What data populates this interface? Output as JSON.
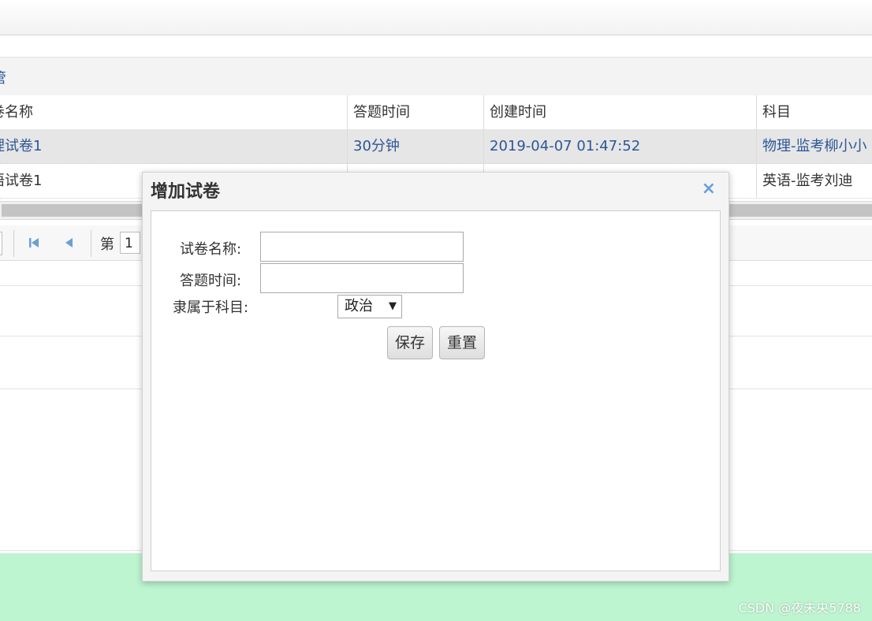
{
  "panel": {
    "title": "管"
  },
  "grid": {
    "headers": [
      "卷名称",
      "答题时间",
      "创建时间",
      "科目"
    ],
    "rows": [
      [
        "理试卷1",
        "30分钟",
        "2019-04-07 01:47:52",
        "物理-监考柳小小"
      ],
      [
        "语试卷1",
        "",
        "",
        "英语-监考刘迪"
      ]
    ]
  },
  "pager": {
    "page_label": "第",
    "page_value": "1"
  },
  "dialog": {
    "title": "增加试卷",
    "close_symbol": "×",
    "fields": {
      "name_label": "试卷名称:",
      "name_value": "",
      "time_label": "答题时间:",
      "time_value": "",
      "subject_label": "隶属于科目:",
      "subject_selected": "政治"
    },
    "buttons": {
      "save": "保存",
      "reset": "重置"
    }
  },
  "watermark": "CSDN @夜未央5788",
  "colors": {
    "link_blue": "#2b5797",
    "accent_icon": "#6a9fd6",
    "footer_green": "#bdf5d0"
  }
}
